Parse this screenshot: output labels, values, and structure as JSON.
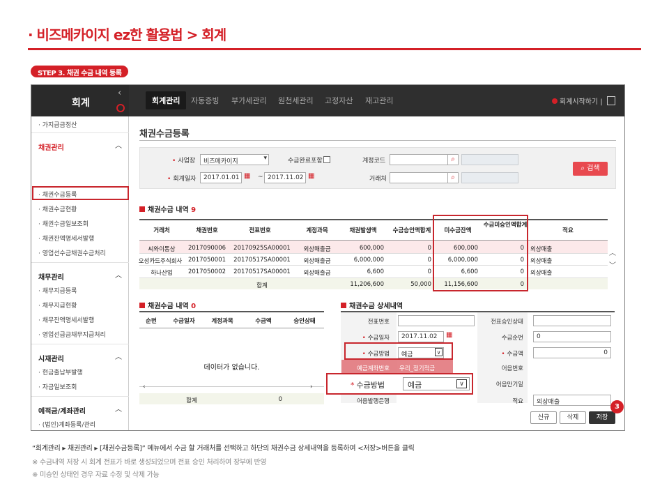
{
  "page_title": "· 비즈메카이지 ez한 활용법 > 회계",
  "step_badge": "STEP 3. 채권 수금 내역 등록",
  "app": {
    "brand": "회계",
    "collapse": "‹",
    "tabs": [
      "회계관리",
      "자동증빙",
      "부가세관리",
      "원천세관리",
      "고정자산",
      "재고관리"
    ],
    "start_label": "회계시작하기",
    "sidebar": [
      {
        "label": "· 가지급금정산",
        "type": "item"
      },
      {
        "label": "채권관리",
        "type": "header",
        "red": true
      },
      {
        "label": "· 채권수금등록",
        "type": "item",
        "selected": true
      },
      {
        "label": "· 채권수금현황",
        "type": "item"
      },
      {
        "label": "· 채권수금일보조회",
        "type": "item"
      },
      {
        "label": "· 채권잔액명세서발행",
        "type": "item"
      },
      {
        "label": "· 영업선수금채권수금처리",
        "type": "item"
      },
      {
        "label": "채무관리",
        "type": "header"
      },
      {
        "label": "· 채무지급등록",
        "type": "item"
      },
      {
        "label": "· 채무지급현황",
        "type": "item"
      },
      {
        "label": "· 채무잔액명세서발행",
        "type": "item"
      },
      {
        "label": "· 영업선급금채무지급처리",
        "type": "item"
      },
      {
        "label": "시재관리",
        "type": "header"
      },
      {
        "label": "· 현금출납부발행",
        "type": "item"
      },
      {
        "label": "· 자금일보조회",
        "type": "item"
      },
      {
        "label": "예적금/계좌관리",
        "type": "header"
      },
      {
        "label": "· (법인)계좌등록/관리",
        "type": "item"
      },
      {
        "label": "· 예적금불입등록",
        "type": "item"
      },
      {
        "label": "· 예적금불입현황",
        "type": "item"
      }
    ],
    "main_title": "채권수금등록",
    "search": {
      "workplace_label": "사업장",
      "workplace_value": "비즈메카이지",
      "include_complete_label": "수금완료포함",
      "account_code_label": "계정코드",
      "account_code_value": "",
      "date_label": "회계일자",
      "date_from": "2017.01.01",
      "date_to": "2017.11.02",
      "tilde": "~",
      "vendor_label": "거래처",
      "vendor_value": "",
      "search_button": "검색"
    },
    "list": {
      "title": "채권수금 내역",
      "count": "9",
      "columns": [
        "거래처",
        "채권번호",
        "전표번호",
        "계정과목",
        "채권발생액",
        "수금승인액합계",
        "미수금잔액",
        "수금미승인액합계",
        "적요"
      ],
      "rows": [
        [
          "씨와이통상",
          "2017090006",
          "20170925SA00001",
          "외상매출금",
          "600,000",
          "0",
          "600,000",
          "0",
          "외상매출"
        ],
        [
          "오성카드주식회사",
          "2017050001",
          "20170517SA00001",
          "외상매출금",
          "6,000,000",
          "0",
          "6,000,000",
          "0",
          "외상매출"
        ],
        [
          "하나산업",
          "2017050002",
          "20170517SA00001",
          "외상매출금",
          "6,600",
          "0",
          "6,600",
          "0",
          "외상매출"
        ]
      ],
      "total_label": "합계",
      "totals": [
        "11,206,600",
        "50,000",
        "11,156,600",
        "0"
      ]
    },
    "receipts": {
      "title": "채권수금 내역",
      "count": "0",
      "columns": [
        "순번",
        "수금일자",
        "계정과목",
        "수금액",
        "승인상태"
      ],
      "empty_text": "데이터가 없습니다.",
      "total_label": "합계",
      "total_value": "0"
    },
    "detail": {
      "title": "채권수금 상세내역",
      "voucher_label": "전표번호",
      "voucher_value": "",
      "approval_label": "전표승인상태",
      "approval_value": "",
      "date_label": "수금일자",
      "date_value": "2017.11.02",
      "seq_label": "수금순번",
      "seq_value": "0",
      "method_label": "수금방법",
      "method_value": "예금",
      "amount_label": "수금액",
      "amount_value": "0",
      "account_no_label": "예금계좌번호",
      "account_no_value": "우리_정기적금",
      "bill_no_label": "어음번호",
      "bill_due_label": "어음만기일",
      "bill_bank_label": "어음발행은행",
      "memo_label": "적요",
      "memo_value": "외상매출",
      "btn_new": "신규",
      "btn_delete": "삭제",
      "btn_save": "저장",
      "step_number": "3"
    },
    "zoom": {
      "label": "수금방법",
      "value": "예금"
    }
  },
  "notes": [
    "“회계관리 ▸ 채권관리 ▸ [채권수금등록]” 메뉴에서 수금 할 거래처를 선택하고 하단의 채권수금 상세내역을 등록하여 <저장>버튼을 클릭",
    "※ 수금내역 저장 시 회계 전표가 바로 생성되었으며 전표 승인 처리하여 장부에 반영",
    "※ 미승인 상태인 경우 자료 수정 및 삭제 가능"
  ],
  "colors": {
    "accent": "#d42027",
    "topbar": "#2f2f2f",
    "highlight_row": "#fce9ea",
    "total_row": "#f3f5ea"
  }
}
